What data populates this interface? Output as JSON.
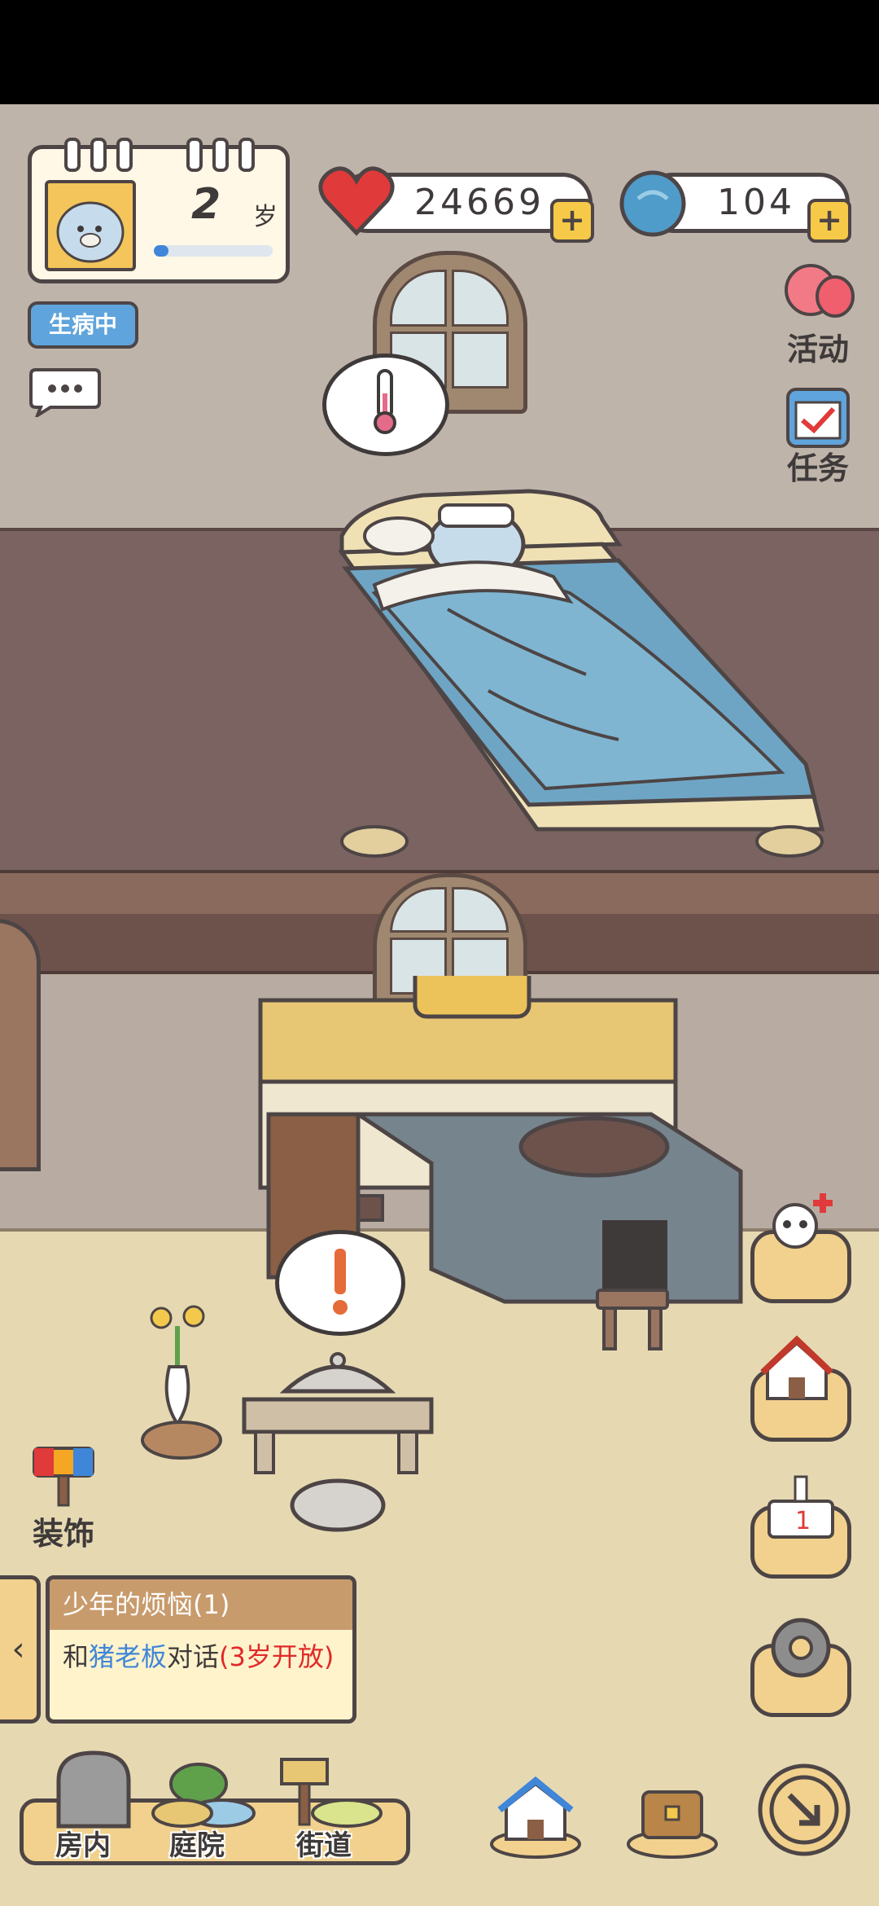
{
  "profile": {
    "age_value": "2",
    "age_unit": "岁",
    "age_progress": 0.12,
    "status_badge": "生病中"
  },
  "resources": {
    "hearts": "24669",
    "clovers": "104"
  },
  "side_menu": {
    "activity": "活动",
    "tasks": "任务",
    "decorate": "装饰"
  },
  "quest": {
    "title": "少年的烦恼(1)",
    "body_prefix": "和",
    "body_highlight": "猪老板",
    "body_suffix": "对话",
    "body_note": "(3岁开放)"
  },
  "bottom_nav": {
    "indoor": "房内",
    "yard": "庭院",
    "street": "街道"
  },
  "colors": {
    "accent_blue": "#3f86d8",
    "warning_red": "#e02a2a",
    "panel_yellow": "#f1d18d"
  },
  "icons": [
    "heart-icon",
    "clover-icon",
    "balloon-icon",
    "clipboard-icon",
    "chat-icon",
    "thermometer-icon",
    "exclamation-icon",
    "panda-heal-icon",
    "house-sign-icon",
    "cake-icon",
    "gear-icon",
    "home-icon",
    "chest-icon",
    "exit-icon",
    "paint-icon"
  ]
}
